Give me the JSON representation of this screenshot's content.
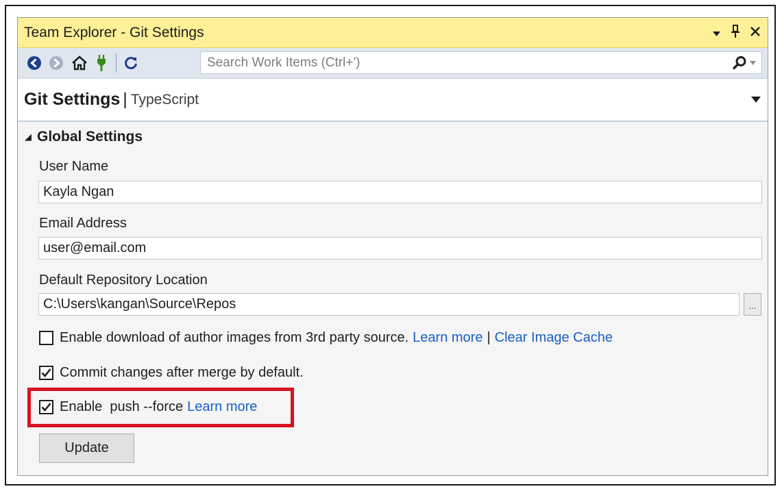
{
  "window": {
    "title": "Team Explorer - Git Settings"
  },
  "toolbar": {
    "search_placeholder": "Search Work Items (Ctrl+')"
  },
  "header": {
    "title": "Git Settings",
    "separator": "|",
    "context": "TypeScript"
  },
  "section": {
    "collapse_glyph": "◢",
    "title": "Global Settings"
  },
  "fields": {
    "user_name_label": "User Name",
    "user_name_value": "Kayla Ngan",
    "email_label": "Email Address",
    "email_value": "user@email.com",
    "repo_location_label": "Default Repository Location",
    "repo_location_value": "C:\\Users\\kangan\\Source\\Repos",
    "browse_label": "..."
  },
  "options": {
    "author_images": {
      "checked": false,
      "label": "Enable download of author images from 3rd party source.",
      "learn_more": "Learn more",
      "separator": "|",
      "clear_cache": "Clear Image Cache"
    },
    "commit_after_merge": {
      "checked": true,
      "label": "Commit changes after merge by default."
    },
    "push_force": {
      "checked": true,
      "label": "Enable  push --force",
      "learn_more": "Learn more"
    }
  },
  "actions": {
    "update_label": "Update"
  },
  "colors": {
    "title_bar": "#fdf097",
    "toolbar": "#dfe6f0",
    "link": "#1a5fc8",
    "highlight": "#d6121f",
    "nav_back": "#1e3f8a",
    "plug": "#3a8a1a"
  },
  "icons": {
    "dropdown": "dropdown-arrow-icon",
    "pin": "pin-icon",
    "close": "close-icon",
    "back": "back-arrow-icon",
    "forward": "forward-arrow-icon",
    "home": "home-icon",
    "connect": "plug-icon",
    "refresh": "refresh-icon",
    "search": "search-icon"
  }
}
